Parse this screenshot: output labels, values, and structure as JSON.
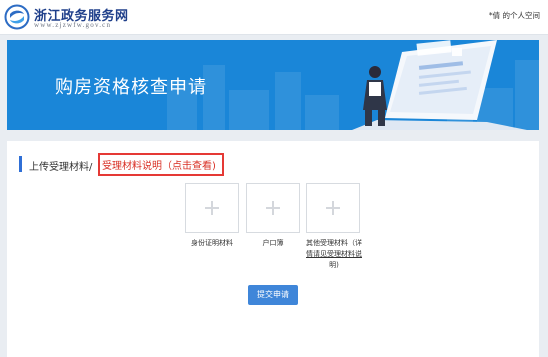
{
  "header": {
    "logo_name": "浙江政务服务网",
    "logo_url": "www.zjzwfw.gov.cn",
    "user_link": "*倩 的个人空间"
  },
  "banner": {
    "title": "购房资格核查申请"
  },
  "section": {
    "title": "上传受理材料",
    "separator": "/",
    "note_link": "受理材料说明（点击查看)"
  },
  "uploads": [
    {
      "label": "身份证明材料"
    },
    {
      "label": "户口簿"
    },
    {
      "label_prefix": "其他受理材料（详",
      "label_link": "情请见受理材料说",
      "label_suffix": "明)"
    }
  ],
  "submit_label": "提交申请",
  "colors": {
    "brand_blue": "#1a86d8",
    "accent_bar": "#2f6fd6",
    "note_red": "#d93025",
    "button_blue": "#3f86d9"
  },
  "icons": [
    "zhejiang-logo-icon",
    "plus-icon"
  ]
}
